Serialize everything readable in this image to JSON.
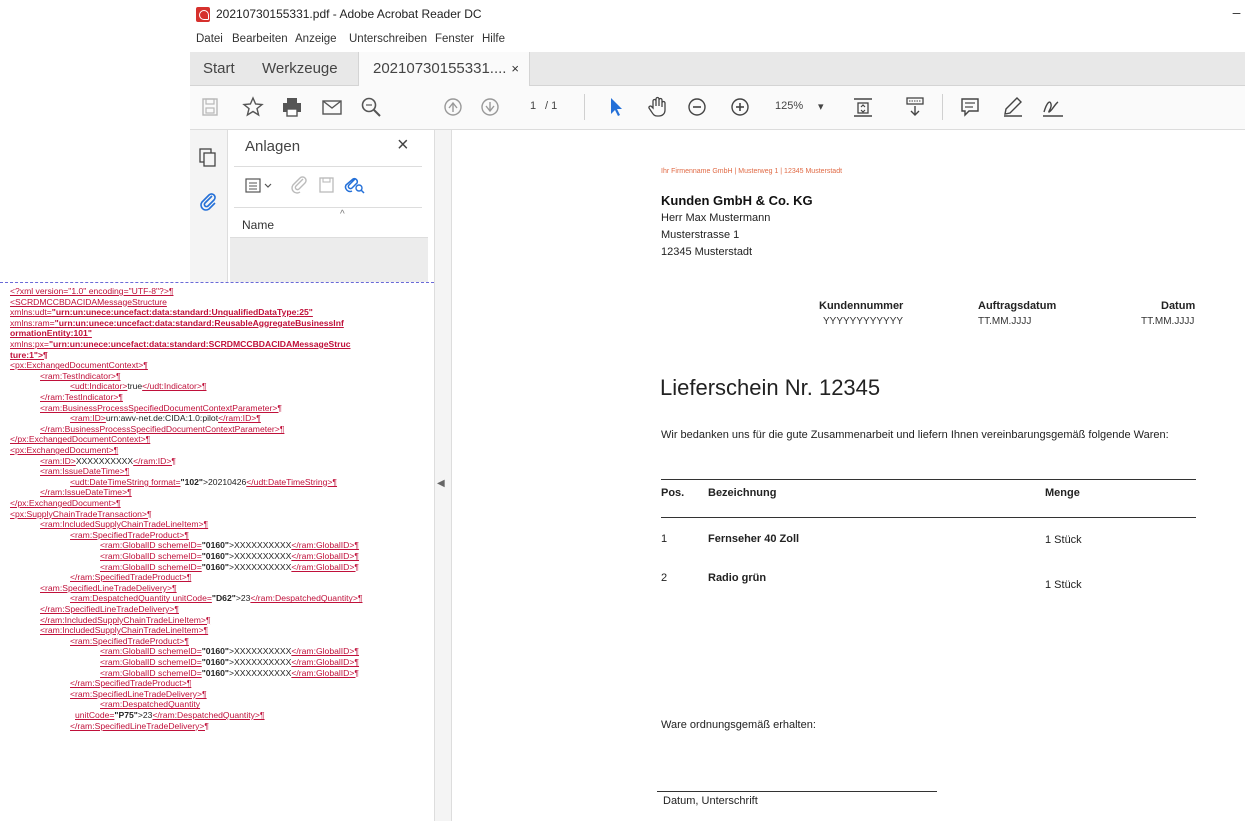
{
  "window": {
    "title": "20210730155331.pdf - Adobe Acrobat Reader DC",
    "minimize": "–"
  },
  "menu": [
    "Datei",
    "Bearbeiten",
    "Anzeige",
    "Unterschreiben",
    "Fenster",
    "Hilfe"
  ],
  "tabs": {
    "start": "Start",
    "tools": "Werkzeuge",
    "document": "20210730155331....",
    "close": "×"
  },
  "toolbar": {
    "page_current": "1",
    "page_total": "/ 1",
    "zoom": "125%",
    "zoom_caret": "▾",
    "icons": [
      "save-icon",
      "bookmark-star-icon",
      "print-icon",
      "email-icon",
      "search-zoom-icon",
      "page-up-icon",
      "page-down-icon",
      "select-arrow-icon",
      "hand-tool-icon",
      "zoom-out-icon",
      "zoom-in-icon",
      "fit-page-icon",
      "scroll-mode-icon",
      "comment-icon",
      "highlight-pen-icon",
      "sign-icon"
    ]
  },
  "attachments_panel": {
    "title": "Anlagen",
    "close": "×",
    "column_name": "Name",
    "sort_indicator": "^"
  },
  "collapse_arrow": "◀",
  "pdf": {
    "sender_line": "Ihr Firmenname GmbH | Musterweg 1 | 12345 Musterstadt",
    "recipient": {
      "company": "Kunden GmbH & Co. KG",
      "name": "Herr Max Mustermann",
      "street": "Musterstrasse 1",
      "city": "12345 Musterstadt"
    },
    "header_fields": [
      {
        "label": "Kundennummer",
        "value": "YYYYYYYYYYYY"
      },
      {
        "label": "Auftragsdatum",
        "value": "TT.MM.JJJJ"
      },
      {
        "label": "Datum",
        "value": "TT.MM.JJJJ"
      }
    ],
    "title": "Lieferschein Nr. 12345",
    "intro": "Wir bedanken uns für die gute Zusammenarbeit und liefern Ihnen vereinbarungsgemäß folgende Waren:",
    "table": {
      "headers": {
        "pos": "Pos.",
        "desc": "Bezeichnung",
        "qty": "Menge"
      },
      "rows": [
        {
          "pos": "1",
          "desc": "Fernseher 40 Zoll",
          "qty": "1 Stück"
        },
        {
          "pos": "2",
          "desc": "Radio grün",
          "qty": "1 Stück"
        }
      ]
    },
    "received": "Ware ordnungsgemäß erhalten:",
    "signature_label": "Datum, Unterschrift"
  },
  "xml": {
    "l01": "<?xml version=\"1.0\" encoding=\"UTF-8\"?>¶",
    "l02": "<SCRDMCCBDACIDAMessageStructure",
    "l03a": "xmlns:udt=",
    "l03b": "\"urn:un:unece:uncefact:data:standard:UnqualifiedDataType:25\"",
    "l04a": "xmlns:ram=",
    "l04b": "\"urn:un:unece:uncefact:data:standard:ReusableAggregateBusinessInf",
    "l05": "ormationEntity:101\"",
    "l06a": "xmlns:px=",
    "l06b": "\"urn:un:unece:uncefact:data:standard:SCRDMCCBDACIDAMessageStruc",
    "l07": "ture:1\">¶",
    "l08": "<px:ExchangedDocumentContext>¶",
    "l09": "<ram:TestIndicator>¶",
    "l10a": "<udt:Indicator>",
    "l10b": "true",
    "l10c": "</udt:Indicator>¶",
    "l11": "</ram:TestIndicator>¶",
    "l12": "<ram:BusinessProcessSpecifiedDocumentContextParameter>¶",
    "l13a": "<ram:ID>",
    "l13b": "urn:awv-net.de:CIDA:1.0:pilot",
    "l13c": "</ram:ID>¶",
    "l14": "</ram:BusinessProcessSpecifiedDocumentContextParameter>¶",
    "l15": "</px:ExchangedDocumentContext>¶",
    "l16": "<px:ExchangedDocument>¶",
    "l17a": "<ram:ID>",
    "l17b": "XXXXXXXXXX",
    "l17c": "</ram:ID>¶",
    "l18": "<ram:IssueDateTime>¶",
    "l19a": "<udt:DateTimeString format=",
    "l19b": "\"102\"",
    "l19c": ">20210426",
    "l19d": "</udt:DateTimeString>¶",
    "l20": "</ram:IssueDateTime>¶",
    "l21": "</px:ExchangedDocument>¶",
    "l22": "<px:SupplyChainTradeTransaction>¶",
    "l23": "<ram:IncludedSupplyChainTradeLineItem>¶",
    "l24": "<ram:SpecifiedTradeProduct>¶",
    "gid_open": "<ram:GlobalID schemeID=",
    "gid_scheme": "\"0160\"",
    "gid_val": ">XXXXXXXXXX",
    "gid_close": "</ram:GlobalID>¶",
    "l28": "</ram:SpecifiedTradeProduct>¶",
    "l29": "<ram:SpecifiedLineTradeDelivery>¶",
    "l30a": "<ram:DespatchedQuantity unitCode=",
    "l30b": "\"D62\"",
    "l30c": ">23",
    "l30d": "</ram:DespatchedQuantity>¶",
    "l31": "</ram:SpecifiedLineTradeDelivery>¶",
    "l32": "</ram:IncludedSupplyChainTradeLineItem>¶",
    "l33": "<ram:IncludedSupplyChainTradeLineItem>¶",
    "l34": "<ram:SpecifiedTradeProduct>¶",
    "l38": "</ram:SpecifiedTradeProduct>¶",
    "l39": "<ram:SpecifiedLineTradeDelivery>¶",
    "l40": "<ram:DespatchedQuantity",
    "l41a": "unitCode=",
    "l41b": "\"P75\"",
    "l41c": ">23",
    "l41d": "</ram:DespatchedQuantity>¶",
    "l42": "</ram:SpecifiedLineTradeDelivery>¶"
  }
}
